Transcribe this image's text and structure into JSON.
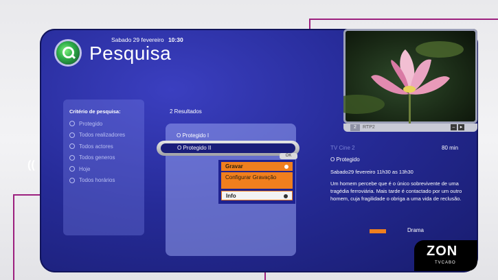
{
  "header": {
    "date": "Sabado 29 fevereiro",
    "time": "10:30",
    "title": "Pesquisa"
  },
  "criteria": {
    "title": "Critério de pesquisa:",
    "items": [
      "Protegido",
      "Todos realizadores",
      "Todos actores",
      "Todos generos",
      "Hoje",
      "Todos horários"
    ]
  },
  "results": {
    "count_label": "2 Resultados",
    "items": [
      "O Protegido I",
      "O Protegido II"
    ],
    "selected_index": 1,
    "ok_label": "OK"
  },
  "context_menu": {
    "items": [
      "Gravar",
      "Configurar Gravação",
      "Info"
    ]
  },
  "preview": {
    "channel_number": "2",
    "channel_name": "RTP2"
  },
  "program_info": {
    "channel": "TV Cine 2",
    "duration": "80 min",
    "title": "O Protegido",
    "schedule": "Sabado29 fevereiro 11h30 as 13h30",
    "description": "Um homem percebe que é o único sobrevivente de uma tragédia ferroviária. Mais tarde é contactado por um outro homem, cuja fragilidade o obriga a uma vida de reclusão.",
    "genre": "Drama"
  },
  "brand": {
    "name": "ZON",
    "tagline": "TVCABO"
  },
  "colors": {
    "accent_orange": "#f07f1e",
    "background_blue": "#262b98",
    "callout_magenta": "#9c1f7e"
  }
}
